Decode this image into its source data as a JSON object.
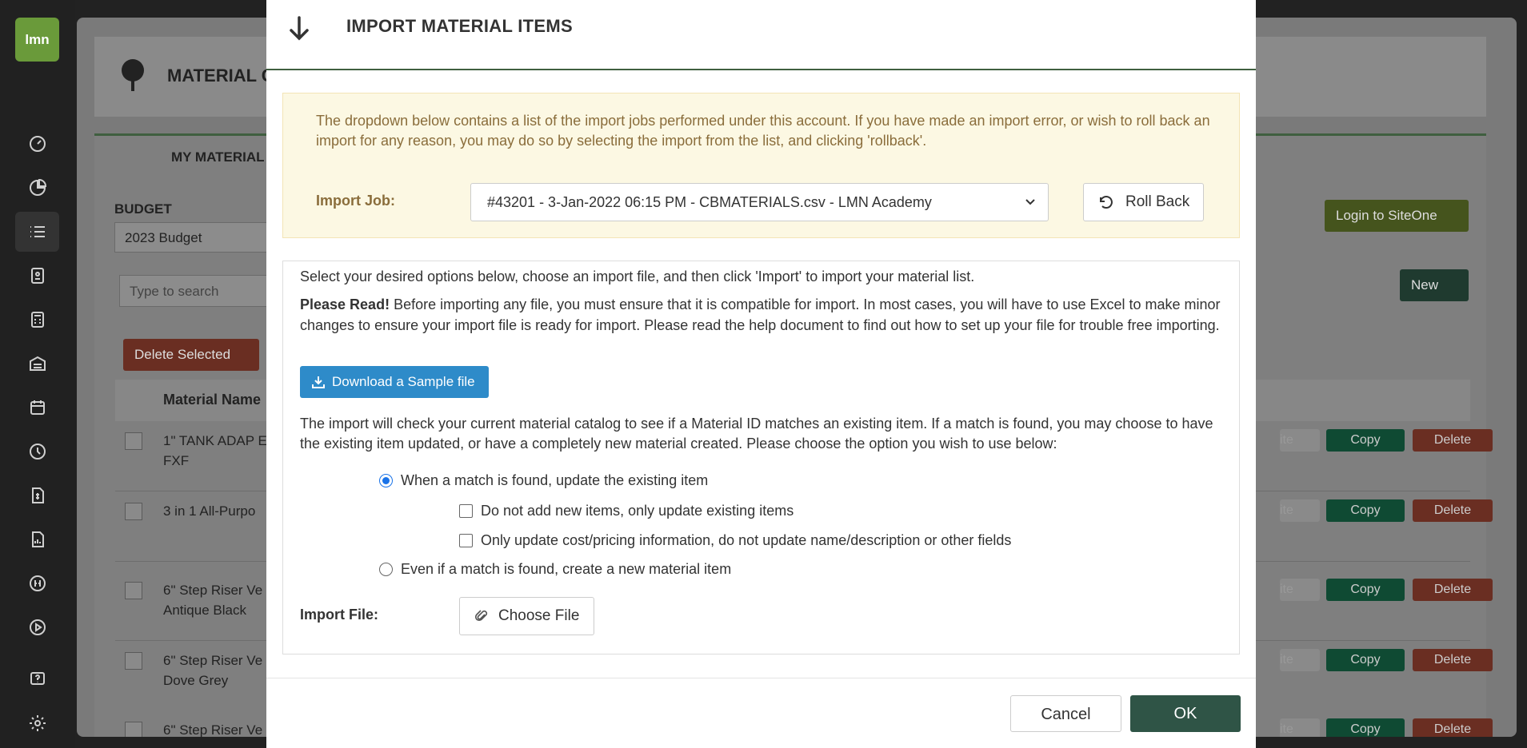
{
  "sidebar": {
    "logo": "lmn",
    "icons": [
      "dashboard-icon",
      "pie-chart-icon",
      "list-icon",
      "clipboard-icon",
      "calculator-icon",
      "warehouse-icon",
      "calendar-icon",
      "clock-icon",
      "invoice-icon",
      "report-icon",
      "quickbooks-icon",
      "play-icon",
      "help-icon",
      "gear-icon"
    ]
  },
  "background": {
    "page_title": "MATERIAL C",
    "tab": "MY MATERIAL",
    "budget_label": "BUDGET",
    "budget_value": "2023 Budget",
    "search_placeholder": "Type to search",
    "delete_selected": "Delete Selected",
    "login_siteone": "Login to SiteOne",
    "new_label": "New",
    "column_material_name": "Material Name",
    "rows": [
      {
        "name": "1\" TANK ADAP E\nFXF"
      },
      {
        "name": "3 in 1 All-Purpo"
      },
      {
        "name": "6\" Step Riser Ve\nAntique Black"
      },
      {
        "name": "6\" Step Riser Ve\nDove Grey"
      },
      {
        "name": "6\" Step Riser Ve"
      }
    ],
    "copy_label": "Copy",
    "delete_label": "Delete",
    "edit_label": "ite"
  },
  "modal": {
    "title": "IMPORT MATERIAL ITEMS",
    "warning_text": "The dropdown below contains a list of the import jobs performed under this account. If you have made an import error, or wish to roll back an import for any reason, you may do so by selecting the import from the list, and clicking 'rollback'.",
    "import_job_label": "Import Job:",
    "import_job_value": "#43201 - 3-Jan-2022 06:15 PM - CBMATERIALS.csv - LMN Academy",
    "rollback_label": "Roll Back",
    "intro": "Select your desired options below, choose an import file, and then click 'Import' to import your material list.",
    "please_read_bold": "Please Read!",
    "please_read_text": " Before importing any file, you must ensure that it is compatible for import. In most cases, you will have to use Excel to make minor changes to ensure your import file is ready for import. Please read the help document to find out how to set up your file for trouble free importing.",
    "download_sample": "Download a Sample file",
    "match_text": "The import will check your current material catalog to see if a Material ID matches an existing item. If a match is found, you may choose to have the existing item updated, or have a completely new material created. Please choose the option you wish to use below:",
    "option_update": "When a match is found, update the existing item",
    "option_no_new": "Do not add new items, only update existing items",
    "option_cost_only": "Only update cost/pricing information, do not update name/description or other fields",
    "option_create_new": "Even if a match is found, create a new material item",
    "import_file_label": "Import File:",
    "choose_file": "Choose File",
    "cancel": "Cancel",
    "ok": "OK"
  }
}
